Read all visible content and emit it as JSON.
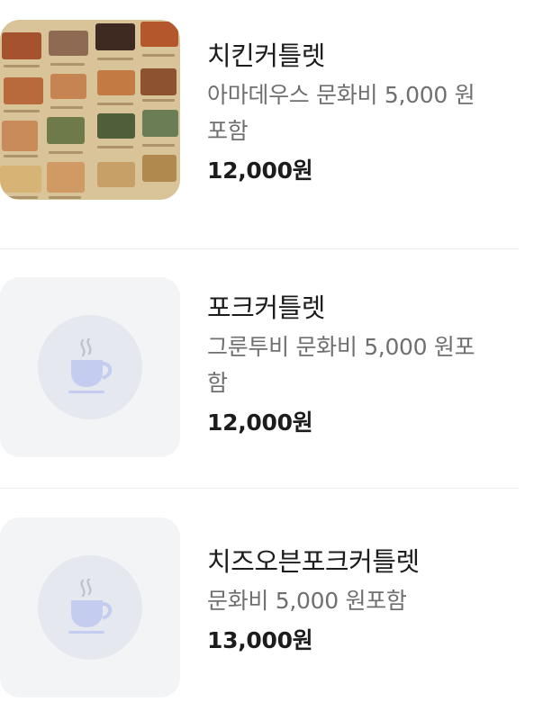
{
  "menu": {
    "items": [
      {
        "name": "치킨커틀렛",
        "description": "아마데우스 문화비 5,000 원\n포함",
        "price": "12,000원",
        "image": "food-menu-photo"
      },
      {
        "name": "포크커틀렛",
        "description": "그룬투비 문화비 5,000 원포\n함",
        "price": "12,000원",
        "image": "coffee-cup-icon"
      },
      {
        "name": "치즈오븐포크커틀렛",
        "description": "문화비 5,000 원포함",
        "price": "13,000원",
        "image": "coffee-cup-icon"
      }
    ]
  },
  "colors": {
    "placeholder_bg": "#f3f4f6",
    "placeholder_circle": "#e6e8ef",
    "cup": "#c4cdf0",
    "steam": "#bfc3cc"
  }
}
